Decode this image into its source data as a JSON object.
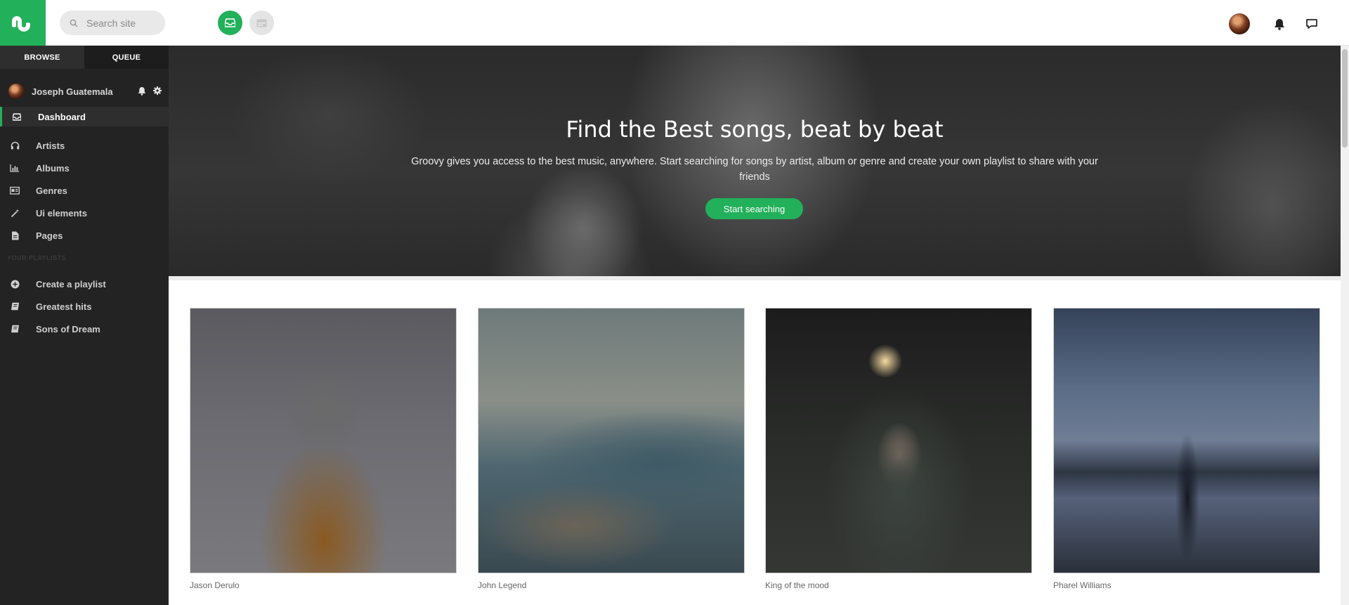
{
  "header": {
    "logo_icon": "stumbleupon-icon",
    "search": {
      "placeholder": "Search site"
    },
    "buttons": [
      {
        "icon": "inbox-icon",
        "color": "#23b05a"
      },
      {
        "icon": "card-icon",
        "color": "#e4e4e4"
      }
    ],
    "right_icons": [
      "avatar",
      "bell-icon",
      "chat-icon"
    ]
  },
  "sidebar": {
    "tabs": [
      "BROWSE",
      "QUEUE"
    ],
    "user": {
      "name": "Joseph Guatemala"
    },
    "items": [
      {
        "label": "Dashboard",
        "icon": "inbox-icon",
        "active": true
      },
      {
        "label": "Artists",
        "icon": "headphones-icon"
      },
      {
        "label": "Albums",
        "icon": "bar-chart-icon"
      },
      {
        "label": "Genres",
        "icon": "genres-icon"
      },
      {
        "label": "Ui elements",
        "icon": "magic-wand-icon"
      },
      {
        "label": "Pages",
        "icon": "file-icon"
      }
    ],
    "section_label": "YOUR PLAYLISTS",
    "playlists": [
      {
        "label": "Create a playlist",
        "icon": "plus-circle-icon"
      },
      {
        "label": "Greatest hits",
        "icon": "book-icon"
      },
      {
        "label": "Sons of Dream",
        "icon": "book-icon"
      }
    ]
  },
  "hero": {
    "title": "Find the Best songs, beat by beat",
    "text": "Groovy gives you access to the best music, anywhere. Start searching for songs by artist, album or genre and create your own playlist to share with your friends",
    "button": "Start searching"
  },
  "cards": [
    {
      "caption": "Jason Derulo"
    },
    {
      "caption": "John Legend"
    },
    {
      "caption": "King of the mood"
    },
    {
      "caption": "Pharel Williams"
    }
  ],
  "colors": {
    "accent": "#23b05a",
    "sidebar": "#232323"
  }
}
